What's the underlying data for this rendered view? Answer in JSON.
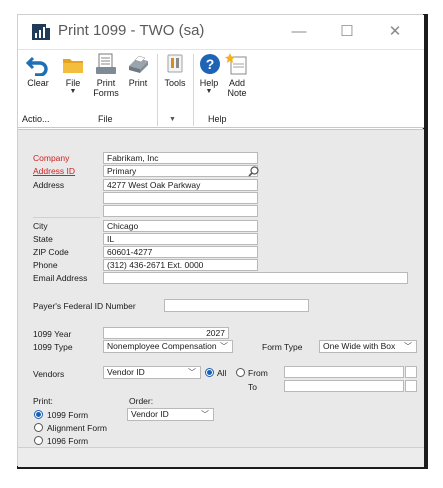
{
  "window": {
    "title": "Print 1099  -  TWO (sa)",
    "controls": {
      "minimize": "—",
      "maximize": "☐",
      "close": "✕"
    }
  },
  "ribbon": {
    "buttons": {
      "clear": "Clear",
      "file": "File",
      "print_forms_line1": "Print",
      "print_forms_line2": "Forms",
      "print": "Print",
      "tools": "Tools",
      "help": "Help",
      "add_note_line1": "Add",
      "add_note_line2": "Note"
    },
    "groups": {
      "actions": "Actio...",
      "file": "File",
      "help": "Help"
    }
  },
  "company": {
    "company_label": "Company",
    "company_value": "Fabrikam, Inc",
    "address_id_label": "Address ID",
    "address_id_value": "Primary",
    "address_label": "Address",
    "address_line1": "4277 West Oak Parkway",
    "address_line2": "",
    "address_line3": "",
    "city_label": "City",
    "city_value": "Chicago",
    "state_label": "State",
    "state_value": "IL",
    "zip_label": "ZIP Code",
    "zip_value": "60601-4277",
    "phone_label": "Phone",
    "phone_value": "(312) 436-2671  Ext. 0000",
    "email_label": "Email Address",
    "email_value": ""
  },
  "payer": {
    "federal_id_label": "Payer's Federal ID Number",
    "federal_id_value": ""
  },
  "options": {
    "year_label": "1099 Year",
    "year_value": "2027",
    "type_label": "1099 Type",
    "type_value": "Nonemployee Compensation",
    "form_type_label": "Form Type",
    "form_type_value": "One Wide with Box",
    "vendors_label": "Vendors",
    "vendors_value": "Vendor ID",
    "all_label": "All",
    "from_label": "From",
    "to_label": "To",
    "from_value": "",
    "to_value": ""
  },
  "print_section": {
    "label": "Print:",
    "options": [
      "1099 Form",
      "Alignment Form",
      "1096 Form"
    ],
    "selected": "1099 Form"
  },
  "order_section": {
    "label": "Order:",
    "value": "Vendor ID"
  }
}
